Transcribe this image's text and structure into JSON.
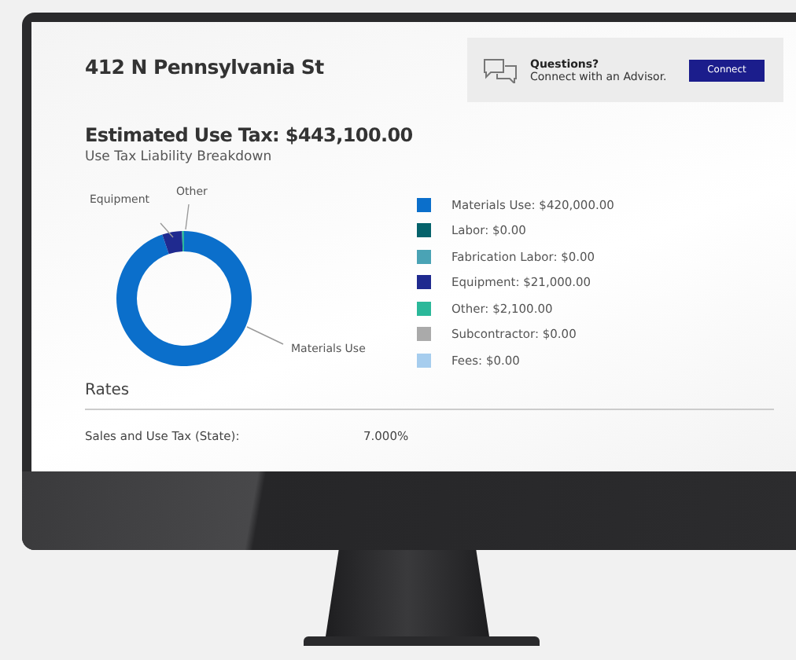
{
  "address": "412 N Pennsylvania St",
  "advisor": {
    "title": "Questions?",
    "text": "Connect with an Advisor.",
    "button": "Connect"
  },
  "estimate": {
    "title": "Estimated Use Tax: $443,100.00",
    "subtitle": "Use Tax Liability Breakdown"
  },
  "chart_data": {
    "type": "donut",
    "values": [
      94.787,
      0,
      0,
      4.739,
      0.474,
      0,
      0
    ],
    "annotations": [
      {
        "text": "Equipment"
      },
      {
        "text": "Other"
      },
      {
        "text": "Materials Use"
      }
    ]
  },
  "legend": [
    {
      "text": "Materials Use: $420,000.00",
      "color": "#0b6fcb"
    },
    {
      "text": "Labor: $0.00",
      "color": "#05626b"
    },
    {
      "text": "Fabrication Labor: $0.00",
      "color": "#4aa3b5"
    },
    {
      "text": "Equipment: $21,000.00",
      "color": "#1f2a8f"
    },
    {
      "text": "Other: $2,100.00",
      "color": "#2bb89a"
    },
    {
      "text": "Subcontractor: $0.00",
      "color": "#aaaaaa"
    },
    {
      "text": "Fees: $0.00",
      "color": "#a6cdee"
    }
  ],
  "rates": {
    "title": "Rates",
    "rows": [
      {
        "label": "Sales and Use Tax (State):",
        "value": "7.000%"
      }
    ]
  }
}
